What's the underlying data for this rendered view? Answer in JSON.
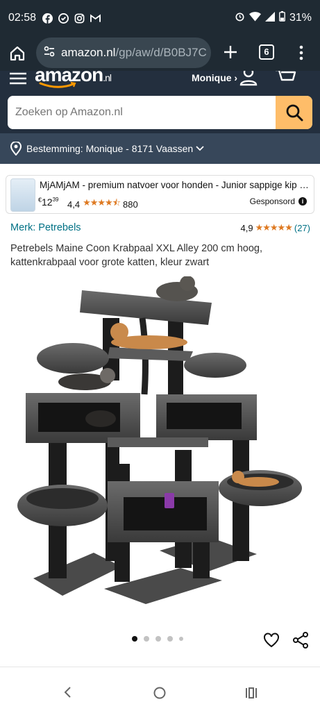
{
  "status_bar": {
    "time": "02:58",
    "battery": "31%"
  },
  "browser": {
    "url_host": "amazon.nl",
    "url_path": "/gp/aw/d/B0BJ7C",
    "tab_count": "6"
  },
  "header": {
    "logo_text": "amazon",
    "logo_suffix": ".nl",
    "account_label": "Monique ›",
    "search_placeholder": "Zoeken op Amazon.nl",
    "location_text": "Bestemming: Monique - 8171 Vaassen"
  },
  "sponsored": {
    "title": "MjAMjAM - premium natvoer voor honden - Junior sappige kip m...",
    "price_currency": "€",
    "price_whole": "12",
    "price_fraction": "39",
    "rating_value": "4,4",
    "rating_stars": "★★★★⯪",
    "review_count": "880",
    "label": "Gesponsord"
  },
  "product": {
    "brand": "Merk: Petrebels",
    "rating_value": "4,9",
    "rating_stars": "★★★★★",
    "review_count": "(27)",
    "title": "Petrebels Maine Coon Krabpaal XXL Alley 200 cm hoog, kattenkrabpaal voor grote katten, kleur zwart",
    "image_index": 1,
    "image_count": 5
  },
  "colors": {
    "status_bg": "#1f2a33",
    "amazon_header": "#232f3e",
    "location_bar": "#37475a",
    "search_button": "#febd69",
    "link": "#007185",
    "star": "#de7921"
  }
}
